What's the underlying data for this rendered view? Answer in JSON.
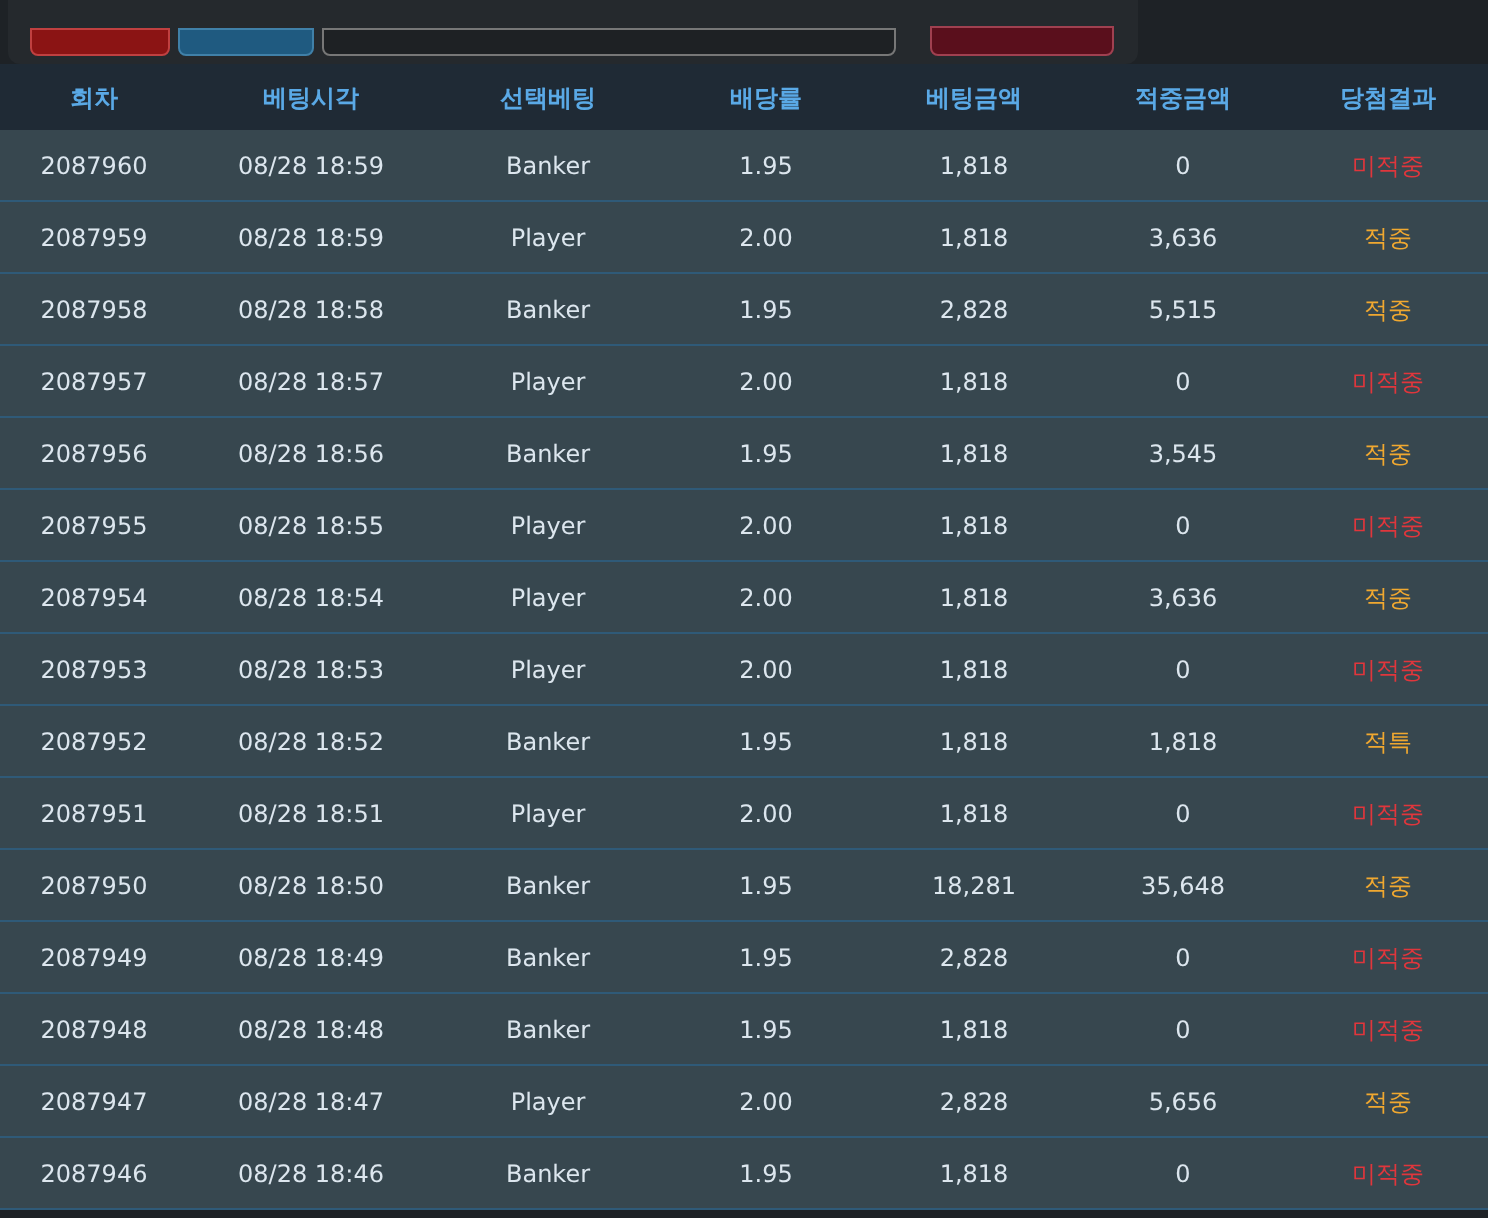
{
  "table": {
    "columns": [
      "회차",
      "베팅시각",
      "선택베팅",
      "배당률",
      "베팅금액",
      "적중금액",
      "당첨결과"
    ],
    "rows": [
      {
        "cells": [
          "2087960",
          "08/28 18:59",
          "Banker",
          "1.95",
          "1,818",
          "0"
        ],
        "result": "미적중",
        "kind": "miss"
      },
      {
        "cells": [
          "2087959",
          "08/28 18:59",
          "Player",
          "2.00",
          "1,818",
          "3,636"
        ],
        "result": "적중",
        "kind": "win"
      },
      {
        "cells": [
          "2087958",
          "08/28 18:58",
          "Banker",
          "1.95",
          "2,828",
          "5,515"
        ],
        "result": "적중",
        "kind": "win"
      },
      {
        "cells": [
          "2087957",
          "08/28 18:57",
          "Player",
          "2.00",
          "1,818",
          "0"
        ],
        "result": "미적중",
        "kind": "miss"
      },
      {
        "cells": [
          "2087956",
          "08/28 18:56",
          "Banker",
          "1.95",
          "1,818",
          "3,545"
        ],
        "result": "적중",
        "kind": "win"
      },
      {
        "cells": [
          "2087955",
          "08/28 18:55",
          "Player",
          "2.00",
          "1,818",
          "0"
        ],
        "result": "미적중",
        "kind": "miss"
      },
      {
        "cells": [
          "2087954",
          "08/28 18:54",
          "Player",
          "2.00",
          "1,818",
          "3,636"
        ],
        "result": "적중",
        "kind": "win"
      },
      {
        "cells": [
          "2087953",
          "08/28 18:53",
          "Player",
          "2.00",
          "1,818",
          "0"
        ],
        "result": "미적중",
        "kind": "miss"
      },
      {
        "cells": [
          "2087952",
          "08/28 18:52",
          "Banker",
          "1.95",
          "1,818",
          "1,818"
        ],
        "result": "적특",
        "kind": "win"
      },
      {
        "cells": [
          "2087951",
          "08/28 18:51",
          "Player",
          "2.00",
          "1,818",
          "0"
        ],
        "result": "미적중",
        "kind": "miss"
      },
      {
        "cells": [
          "2087950",
          "08/28 18:50",
          "Banker",
          "1.95",
          "18,281",
          "35,648"
        ],
        "result": "적중",
        "kind": "win"
      },
      {
        "cells": [
          "2087949",
          "08/28 18:49",
          "Banker",
          "1.95",
          "2,828",
          "0"
        ],
        "result": "미적중",
        "kind": "miss"
      },
      {
        "cells": [
          "2087948",
          "08/28 18:48",
          "Banker",
          "1.95",
          "1,818",
          "0"
        ],
        "result": "미적중",
        "kind": "miss"
      },
      {
        "cells": [
          "2087947",
          "08/28 18:47",
          "Player",
          "2.00",
          "2,828",
          "5,656"
        ],
        "result": "적중",
        "kind": "win"
      },
      {
        "cells": [
          "2087946",
          "08/28 18:46",
          "Banker",
          "1.95",
          "1,818",
          "0"
        ],
        "result": "미적중",
        "kind": "miss"
      }
    ]
  }
}
